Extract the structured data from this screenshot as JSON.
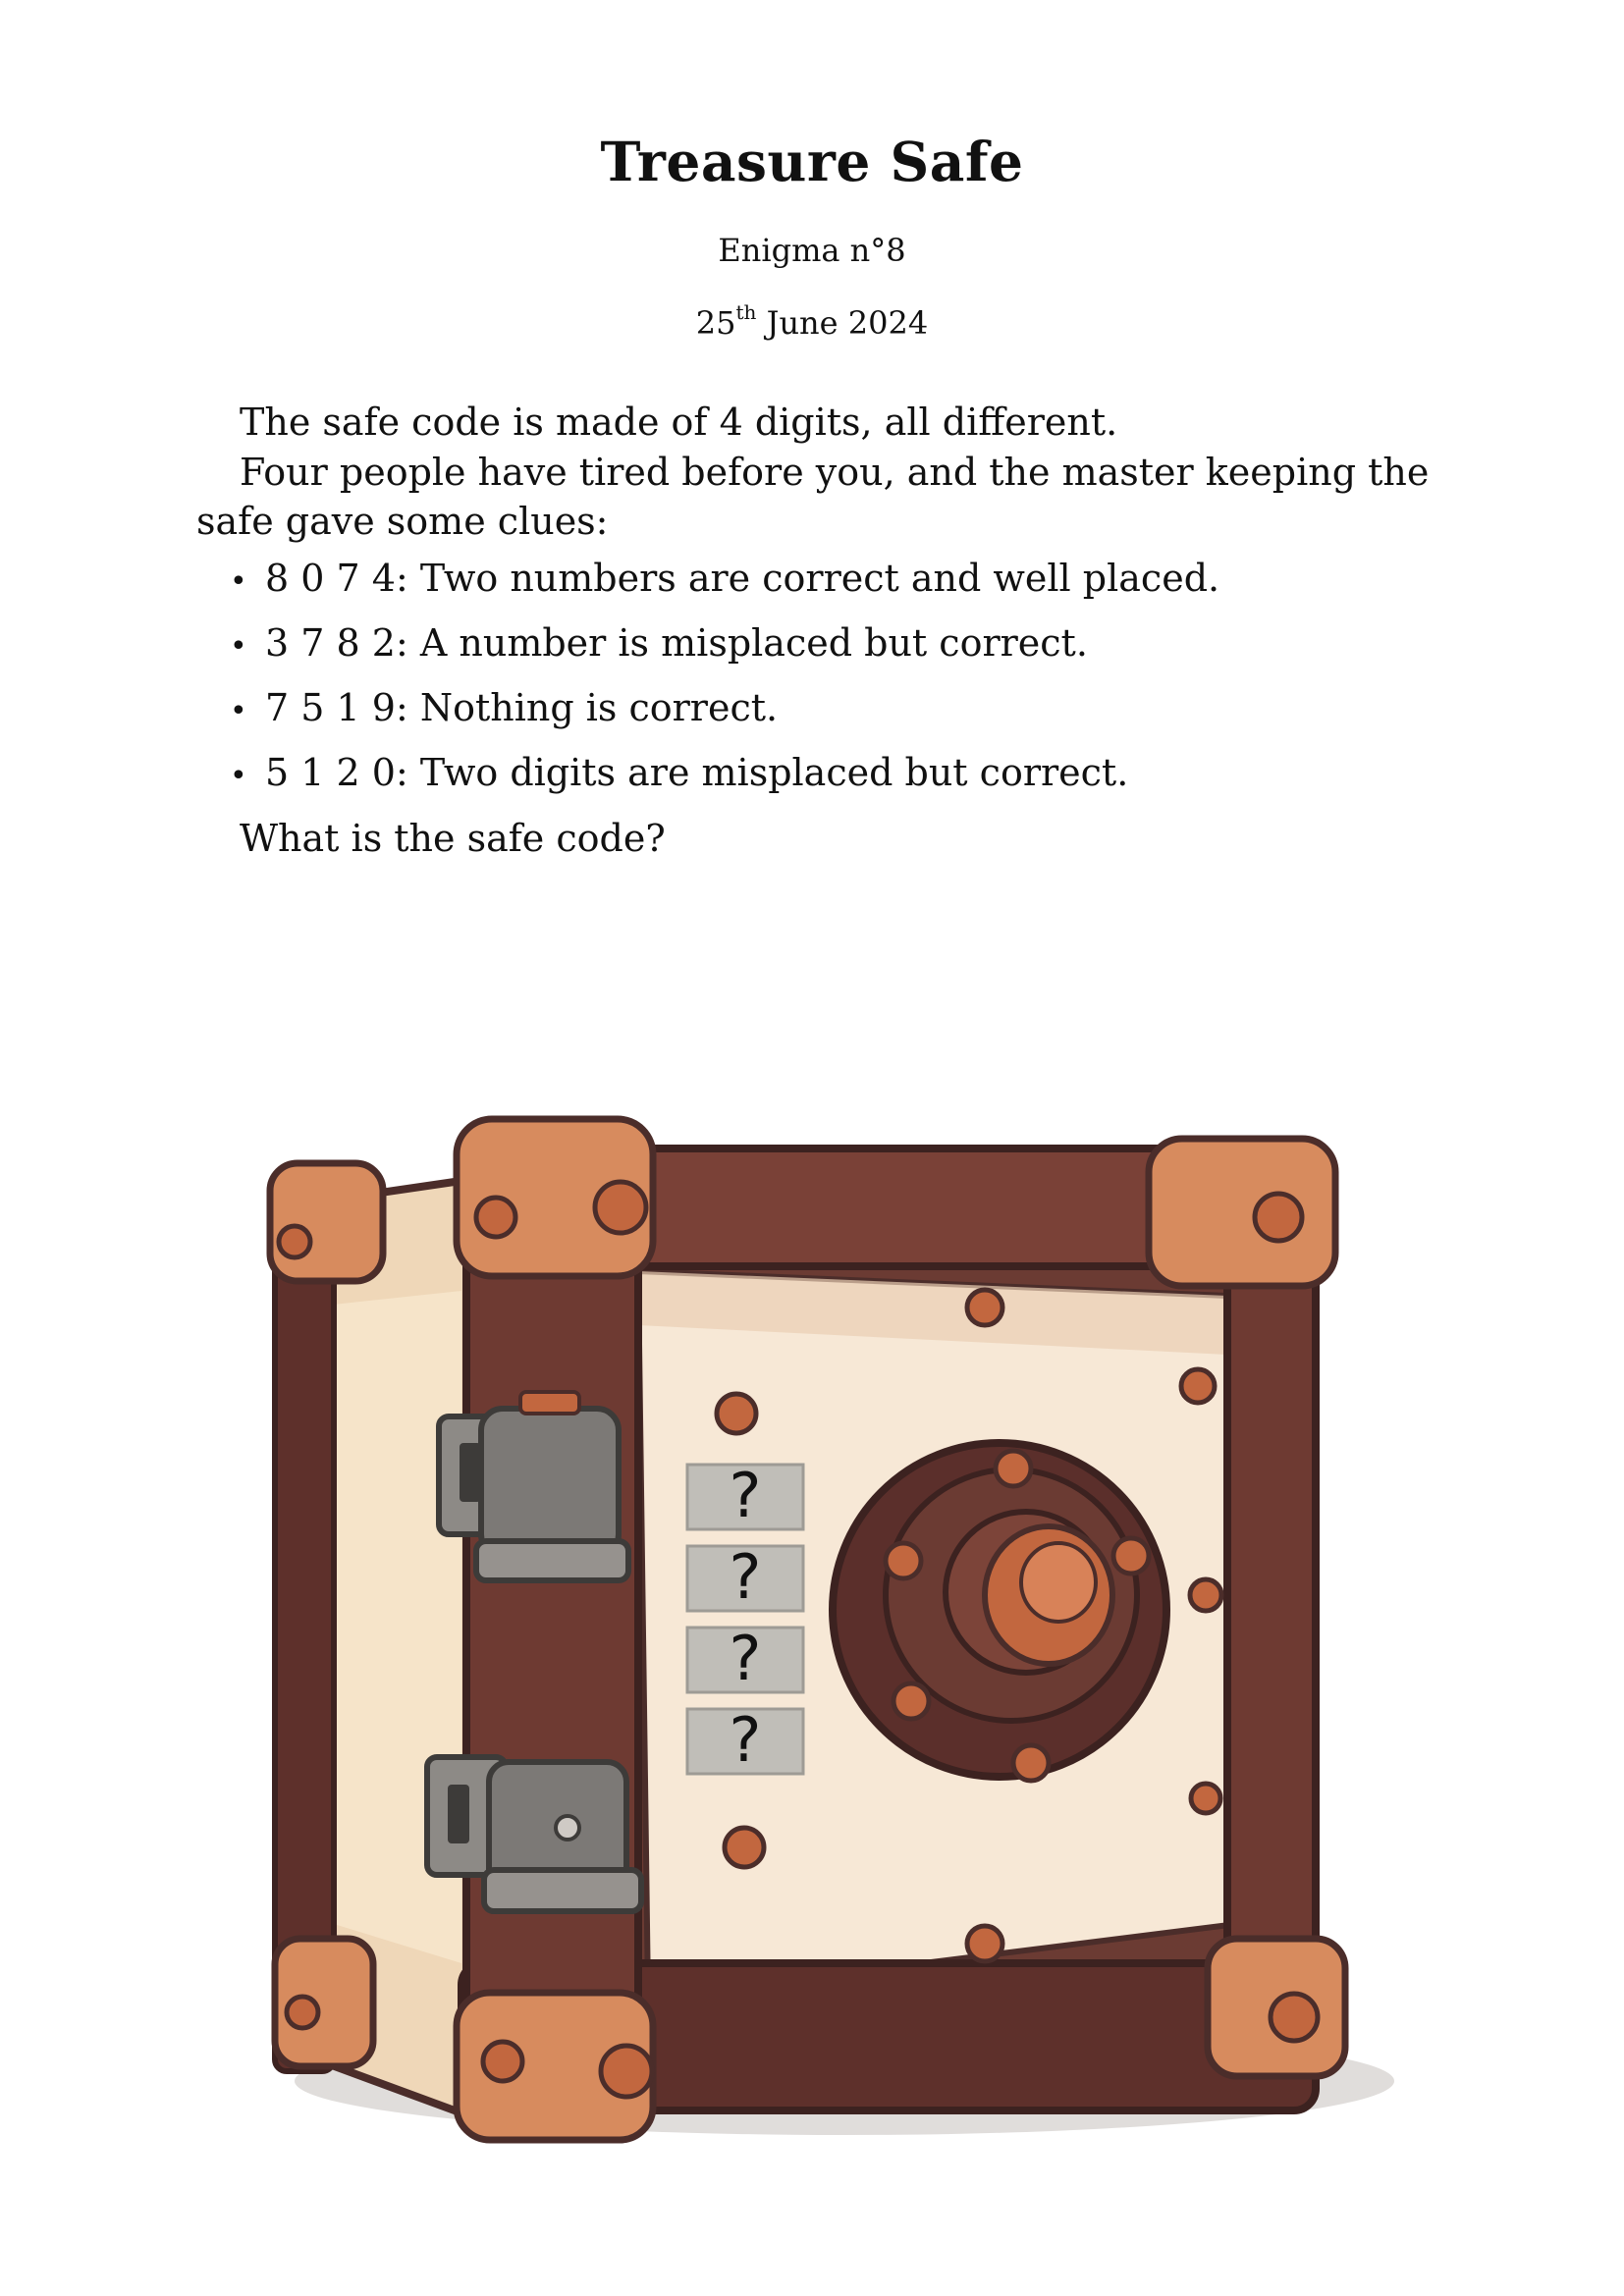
{
  "header": {
    "title": "Treasure Safe",
    "enigma": "Enigma n°8",
    "date_day": "25",
    "date_suffix": "th",
    "date_rest": " June 2024"
  },
  "intro": {
    "line1": "The safe code is made of 4 digits, all different.",
    "line2": "Four people have tired before you, and the master keeping the safe gave some clues:"
  },
  "clues": [
    {
      "code": "8 0 7 4:",
      "text": "Two numbers are correct and well placed."
    },
    {
      "code": "3 7 8 2:",
      "text": "A number is misplaced but correct."
    },
    {
      "code": "7 5 1 9:",
      "text": "Nothing is correct."
    },
    {
      "code": "5 1 2 0:",
      "text": "Two digits are misplaced but correct."
    }
  ],
  "question": "What is the safe code?",
  "safe": {
    "code_slots": [
      "?",
      "?",
      "?",
      "?"
    ]
  }
}
